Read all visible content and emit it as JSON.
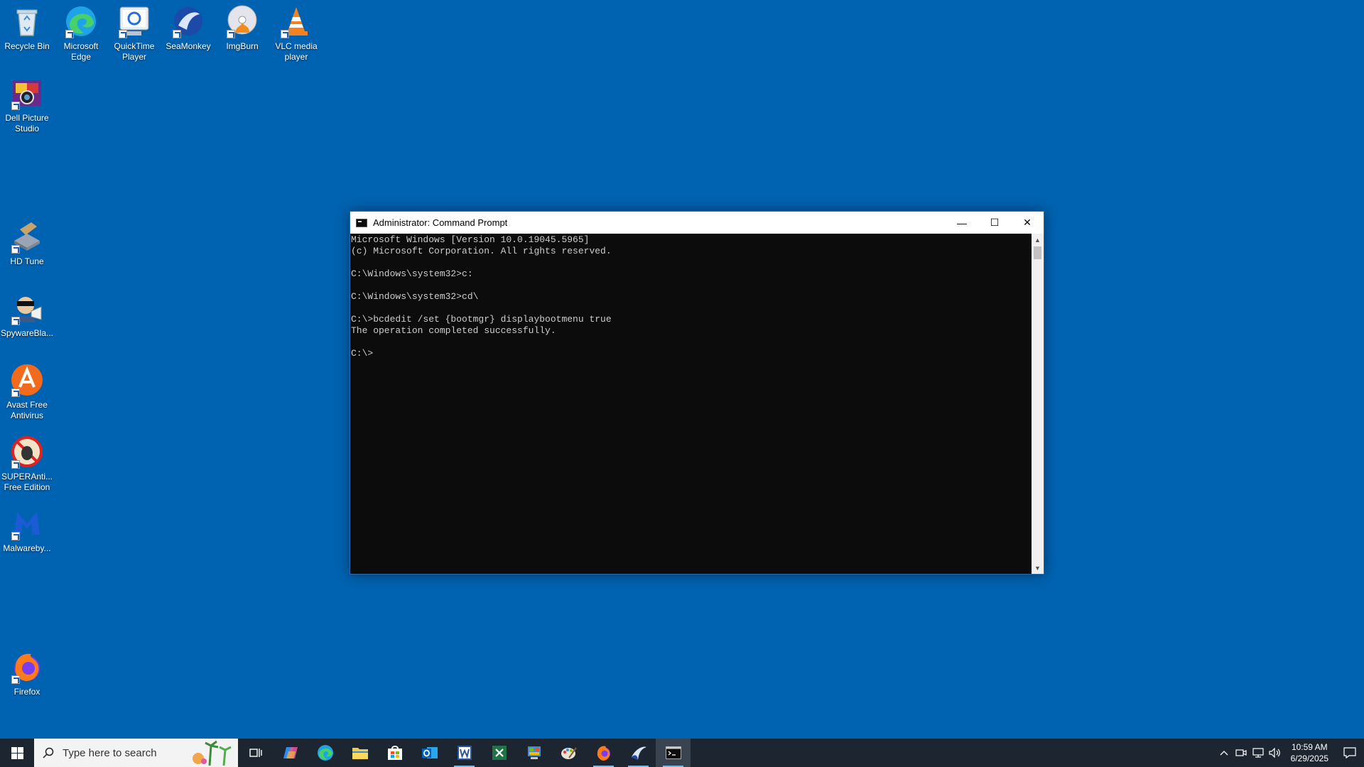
{
  "desktop": {
    "icons": [
      {
        "label": "Recycle Bin",
        "icon": "recycle-bin-icon"
      },
      {
        "label": "Microsoft Edge",
        "icon": "edge-icon"
      },
      {
        "label": "QuickTime Player",
        "icon": "quicktime-icon"
      },
      {
        "label": "SeaMonkey",
        "icon": "seamonkey-icon"
      },
      {
        "label": "ImgBurn",
        "icon": "imgburn-icon"
      },
      {
        "label": "VLC media player",
        "icon": "vlc-icon"
      },
      {
        "label": "Dell Picture Studio",
        "icon": "dell-picture-studio-icon"
      },
      {
        "label": "HD Tune",
        "icon": "hd-tune-icon"
      },
      {
        "label": "SpywareBla...",
        "icon": "spywareblaster-icon"
      },
      {
        "label": "Avast Free Antivirus",
        "icon": "avast-icon"
      },
      {
        "label": "SUPERAnti... Free Edition",
        "icon": "superantispyware-icon"
      },
      {
        "label": "Malwareby...",
        "icon": "malwarebytes-icon"
      },
      {
        "label": "Firefox",
        "icon": "firefox-icon"
      }
    ]
  },
  "cmd": {
    "title": "Administrator: Command Prompt",
    "minimize": "—",
    "maximize": "☐",
    "close": "✕",
    "output": "Microsoft Windows [Version 10.0.19045.5965]\n(c) Microsoft Corporation. All rights reserved.\n\nC:\\Windows\\system32>c:\n\nC:\\Windows\\system32>cd\\\n\nC:\\>bcdedit /set {bootmgr} displaybootmenu true\nThe operation completed successfully.\n\nC:\\>"
  },
  "taskbar": {
    "search_placeholder": "Type here to search",
    "apps": [
      "task-view-icon",
      "copilot-icon",
      "edge-icon",
      "file-explorer-icon",
      "store-icon",
      "outlook-icon",
      "word-icon",
      "excel-icon",
      "control-panel-icon",
      "paint-icon",
      "firefox-icon",
      "seamonkey-icon",
      "command-prompt-icon"
    ],
    "time": "10:59 AM",
    "date": "6/29/2025"
  },
  "colors": {
    "desktop": "#0063b1",
    "taskbar": "#1c2530",
    "console_bg": "#0c0c0c",
    "console_fg": "#cccccc"
  }
}
